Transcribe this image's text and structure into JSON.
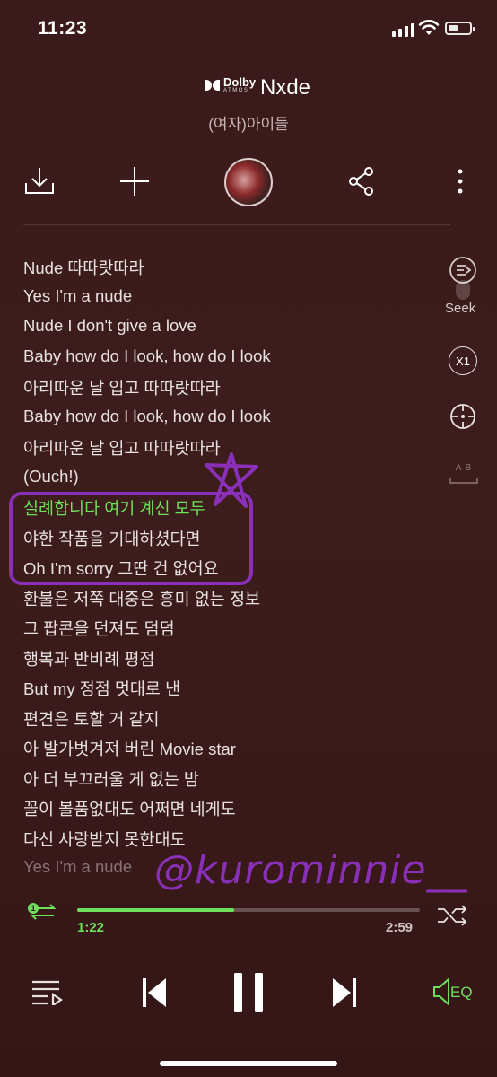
{
  "status_bar": {
    "time": "11:23"
  },
  "header": {
    "dolby_brand": "Dolby",
    "dolby_sub": "ATMOS",
    "title": "Nxde",
    "artist": "(여자)아이들"
  },
  "lyrics": [
    "Nude 따따랏따라",
    "Yes I'm a nude",
    "Nude I don't give a love",
    "Baby how do I look, how do I look",
    "아리따운 날 입고 따따랏따라",
    "Baby how do I look, how do I look",
    "아리따운 날 입고 따따랏따라",
    "(Ouch!)",
    "실례합니다 여기 계신 모두",
    "야한 작품을 기대하셨다면",
    "Oh I'm sorry 그딴 건 없어요",
    "환불은 저쪽 대중은 흥미 없는 정보",
    "그 팝콘을 던져도 덤덤",
    "행복과 반비례 평점",
    "But my 정점 멋대로 낸",
    "편견은 토할 거 같지",
    "아 발가벗겨져 버린 Movie star",
    "아 더 부끄러울 게 없는 밤",
    "꼴이 볼품없대도 어쩌면 네게도",
    "다신 사랑받지 못한대도",
    "Yes I'm a nude"
  ],
  "active_lyric_index": 8,
  "side_controls": {
    "seek_label": "Seek",
    "speed_label": "X1",
    "ab_label": "A B"
  },
  "watermark": "@kurominnie__",
  "playback": {
    "current_time": "1:22",
    "total_time": "2:59",
    "progress_fraction": 0.459,
    "repeat_badge": "1"
  },
  "bottom_controls": {
    "eq_label": "EQ"
  },
  "colors": {
    "accent": "#6fe05a",
    "annotation": "#8a2fb8",
    "background": "#3a1a1a"
  }
}
